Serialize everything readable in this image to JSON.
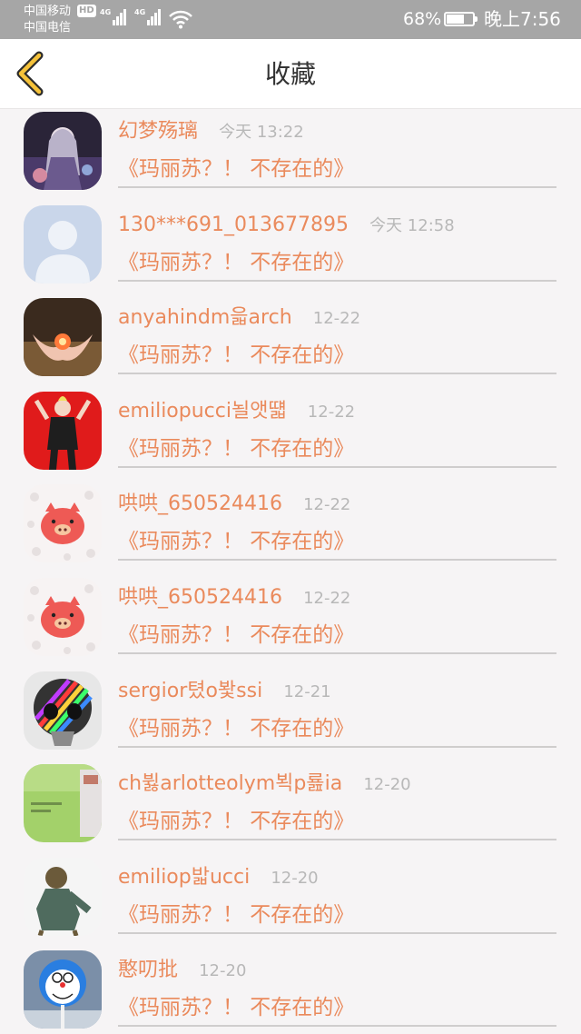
{
  "status_bar": {
    "carrier1": "中国移动",
    "carrier2": "中国电信",
    "hd": "HD",
    "network1": "4G",
    "network2": "4G",
    "battery_percent": "68%",
    "battery_level": 0.68,
    "time": "晚上7:56"
  },
  "header": {
    "title": "收藏",
    "back_icon": "chevron-left-icon"
  },
  "favorites": [
    {
      "username": "幻梦殇璃",
      "time": "今天 13:22",
      "book": "《玛丽苏？！ 不存在的》",
      "avatar": "anime-girl"
    },
    {
      "username": "130***691_013677895",
      "time": "今天 12:58",
      "book": "《玛丽苏？！ 不存在的》",
      "avatar": "default-person"
    },
    {
      "username": "anyahindm읇arch",
      "time": "12-22",
      "book": "《玛丽苏？！ 不存在的》",
      "avatar": "glowing-hands"
    },
    {
      "username": "emiliopucci뇔앳떏",
      "time": "12-22",
      "book": "《玛丽苏？！ 不存在的》",
      "avatar": "figure-red"
    },
    {
      "username": "哄哄_650524416",
      "time": "12-22",
      "book": "《玛丽苏？！ 不存在的》",
      "avatar": "pig-cartoon"
    },
    {
      "username": "哄哄_650524416",
      "time": "12-22",
      "book": "《玛丽苏？！ 不存在的》",
      "avatar": "pig-cartoon"
    },
    {
      "username": "sergior텼o봧ssi",
      "time": "12-21",
      "book": "《玛丽苏？！ 不存在的》",
      "avatar": "rainbow-skull"
    },
    {
      "username": "ch뷣arlotteolym뵉p룚ia",
      "time": "12-20",
      "book": "《玛丽苏？！ 不存在的》",
      "avatar": "green-screenshot"
    },
    {
      "username": "emiliop밟ucci",
      "time": "12-20",
      "book": "《玛丽苏？！ 不存在的》",
      "avatar": "bronze-statue"
    },
    {
      "username": "憨叨批",
      "time": "12-20",
      "book": "《玛丽苏？！ 不存在的》",
      "avatar": "doraemon-lollipop"
    }
  ]
}
